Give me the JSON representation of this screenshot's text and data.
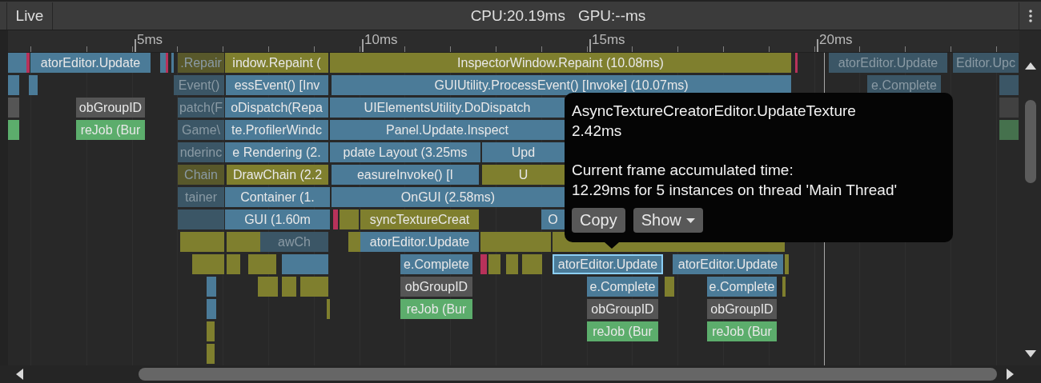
{
  "toolbar": {
    "live_button": "Live",
    "cpu": "CPU:20.19ms",
    "gpu": "GPU:--ms"
  },
  "ruler": {
    "labels": [
      "5ms",
      "10ms",
      "15ms",
      "20ms"
    ]
  },
  "blocks": [
    {
      "color": "#4b7b98",
      "selected": false
    },
    {
      "color": "#b8325a",
      "selected": false
    },
    {
      "label": "atorEditor.Update",
      "color": "#4b7b98",
      "dimmed": false,
      "selected": false
    },
    {
      "color": "#4b7b98",
      "selected": false
    },
    {
      "color": "#b8325a",
      "selected": false
    },
    {
      "color": "#4b7b98",
      "selected": false
    },
    {
      "label": ".Repair",
      "color": "#58582b",
      "dimmed": true,
      "selected": false
    },
    {
      "label": "indow.Repaint (",
      "color": "#7f7f2e",
      "dimmed": false,
      "selected": false
    },
    {
      "label": "InspectorWindow.Repaint (10.08ms)",
      "color": "#7f7f2e",
      "dimmed": false,
      "selected": false
    },
    {
      "color": "#b8325a",
      "selected": false
    },
    {
      "label": "atorEditor.Update",
      "color": "#3b5666",
      "dimmed": true,
      "selected": false
    },
    {
      "label": "Editor.Upc",
      "color": "#3b5666",
      "dimmed": true,
      "selected": false
    },
    {
      "color": "#4b7b98",
      "selected": false
    },
    {
      "color": "#4b7b98",
      "selected": false
    },
    {
      "label": "Event()",
      "color": "#3b5666",
      "dimmed": true,
      "selected": false
    },
    {
      "label": "essEvent() [Inv",
      "color": "#4b7b98",
      "dimmed": false,
      "selected": false
    },
    {
      "label": "GUIUtility.ProcessEvent() [Invoke] (10.07ms)",
      "color": "#4b7b98",
      "dimmed": false,
      "selected": false
    },
    {
      "label": "e.Complete",
      "color": "#3b5666",
      "dimmed": true,
      "selected": false
    },
    {
      "color": "#3b5666",
      "selected": false
    },
    {
      "color": "#555555",
      "selected": false
    },
    {
      "label": "obGroupID",
      "color": "#555555",
      "dimmed": false,
      "selected": false
    },
    {
      "label": "patch(F",
      "color": "#3b5666",
      "dimmed": true,
      "selected": false
    },
    {
      "label": "oDispatch(Repa",
      "color": "#4b7b98",
      "dimmed": false,
      "selected": false
    },
    {
      "label": "UIElementsUtility.DoDispatch",
      "color": "#4b7b98",
      "dimmed": false,
      "selected": false
    },
    {
      "color": "#414141",
      "selected": false
    },
    {
      "color": "#5cad6c",
      "selected": false
    },
    {
      "label": "reJob (Bur",
      "color": "#5cad6c",
      "dimmed": false,
      "selected": false
    },
    {
      "label": "Game\\",
      "color": "#3b5666",
      "dimmed": true,
      "selected": false
    },
    {
      "label": "te.ProfilerWindc",
      "color": "#4b7b98",
      "dimmed": false,
      "selected": false
    },
    {
      "label": "Panel.Update.Inspect",
      "color": "#4b7b98",
      "dimmed": false,
      "selected": false
    },
    {
      "color": "#45714d",
      "selected": false
    },
    {
      "label": "nderinc",
      "color": "#3b5666",
      "dimmed": true,
      "selected": false
    },
    {
      "label": "e Rendering (2.",
      "color": "#4b7b98",
      "dimmed": false,
      "selected": false
    },
    {
      "label": "pdate Layout (3.25ms",
      "color": "#4b7b98",
      "dimmed": false,
      "selected": false
    },
    {
      "label": "Upd",
      "color": "#4b7b98",
      "dimmed": false,
      "selected": false
    },
    {
      "label": "Chain",
      "color": "#58582b",
      "dimmed": true,
      "selected": false
    },
    {
      "label": "DrawChain (2.2",
      "color": "#7f7f2e",
      "dimmed": false,
      "selected": false
    },
    {
      "label": "easureInvoke() [I",
      "color": "#4b7b98",
      "dimmed": false,
      "selected": false
    },
    {
      "label": "U",
      "color": "#7f7f2e",
      "dimmed": false,
      "selected": false
    },
    {
      "label": "tainer",
      "color": "#3b5666",
      "dimmed": true,
      "selected": false
    },
    {
      "label": "Container (1.",
      "color": "#4b7b98",
      "dimmed": false,
      "selected": false
    },
    {
      "label": "OnGUI (2.58ms)",
      "color": "#4b7b98",
      "dimmed": false,
      "selected": false
    },
    {
      "color": "#3b5666",
      "selected": false
    },
    {
      "label": "GUI (1.60m",
      "color": "#4b7b98",
      "dimmed": false,
      "selected": false
    },
    {
      "color": "#b8325a",
      "selected": false
    },
    {
      "color": "#7f7f2e",
      "selected": false
    },
    {
      "label": "syncTextureCreat",
      "color": "#7f7f2e",
      "dimmed": false,
      "selected": false
    },
    {
      "label": "O",
      "color": "#4b7b98",
      "dimmed": false,
      "selected": false
    },
    {
      "color": "#7f7f2e",
      "selected": false
    },
    {
      "color": "#7f7f2e",
      "selected": false
    },
    {
      "label": "awCh",
      "color": "#3b5666",
      "dimmed": true,
      "selected": false
    },
    {
      "color": "#7f7f2e",
      "selected": false
    },
    {
      "label": "atorEditor.Update",
      "color": "#4b7b98",
      "dimmed": false,
      "selected": false
    },
    {
      "color": "#7f7f2e",
      "selected": false
    },
    {
      "color": "#7f7f2e",
      "selected": false
    },
    {
      "color": "#7f7f2e",
      "selected": false
    },
    {
      "color": "#7f7f2e",
      "selected": false
    },
    {
      "color": "#7f7f2e",
      "selected": false
    },
    {
      "color": "#4b7b98",
      "selected": false
    },
    {
      "label": "e.Complete",
      "color": "#4b7b98",
      "dimmed": false,
      "selected": false
    },
    {
      "color": "#b8325a",
      "selected": false
    },
    {
      "color": "#7f7f2e",
      "selected": false
    },
    {
      "color": "#7f7f2e",
      "selected": false
    },
    {
      "color": "#7f7f2e",
      "selected": false
    },
    {
      "label": "atorEditor.Update",
      "color": "#4b7b98",
      "dimmed": false,
      "selected": true
    },
    {
      "label": "atorEditor.Update",
      "color": "#4b7b98",
      "dimmed": false,
      "selected": false
    },
    {
      "color": "#7f7f2e",
      "selected": false
    },
    {
      "color": "#4b7b98",
      "selected": false
    },
    {
      "color": "#7f7f2e",
      "selected": false
    },
    {
      "color": "#7f7f2e",
      "selected": false
    },
    {
      "color": "#7f7f2e",
      "selected": false
    },
    {
      "label": "obGroupID",
      "color": "#555555",
      "dimmed": false,
      "selected": false
    },
    {
      "label": "e.Complete",
      "color": "#4b7b98",
      "dimmed": false,
      "selected": false
    },
    {
      "color": "#7f7f2e",
      "selected": false
    },
    {
      "label": "e.Complete",
      "color": "#4b7b98",
      "dimmed": false,
      "selected": false
    },
    {
      "color": "#7f7f2e",
      "selected": false
    },
    {
      "color": "#4b7b98",
      "selected": false
    },
    {
      "color": "#7f7f2e",
      "selected": false
    },
    {
      "label": "reJob (Bur",
      "color": "#5cad6c",
      "dimmed": false,
      "selected": false
    },
    {
      "label": "obGroupID",
      "color": "#555555",
      "dimmed": false,
      "selected": false
    },
    {
      "label": "obGroupID",
      "color": "#555555",
      "dimmed": false,
      "selected": false
    },
    {
      "color": "#7f7f2e",
      "selected": false
    },
    {
      "label": "reJob (Bur",
      "color": "#5cad6c",
      "dimmed": false,
      "selected": false
    },
    {
      "label": "reJob (Bur",
      "color": "#5cad6c",
      "dimmed": false,
      "selected": false
    },
    {
      "color": "#7f7f2e",
      "selected": false
    }
  ],
  "tooltip": {
    "title": "AsyncTextureCreatorEditor.UpdateTexture",
    "time": "2.42ms",
    "caption": "Current frame accumulated time:",
    "detail": "12.29ms for 5 instances on thread 'Main Thread'",
    "buttons": [
      {
        "label": "Copy",
        "kind": "plain"
      },
      {
        "label": "Show",
        "kind": "dropdown"
      }
    ]
  }
}
